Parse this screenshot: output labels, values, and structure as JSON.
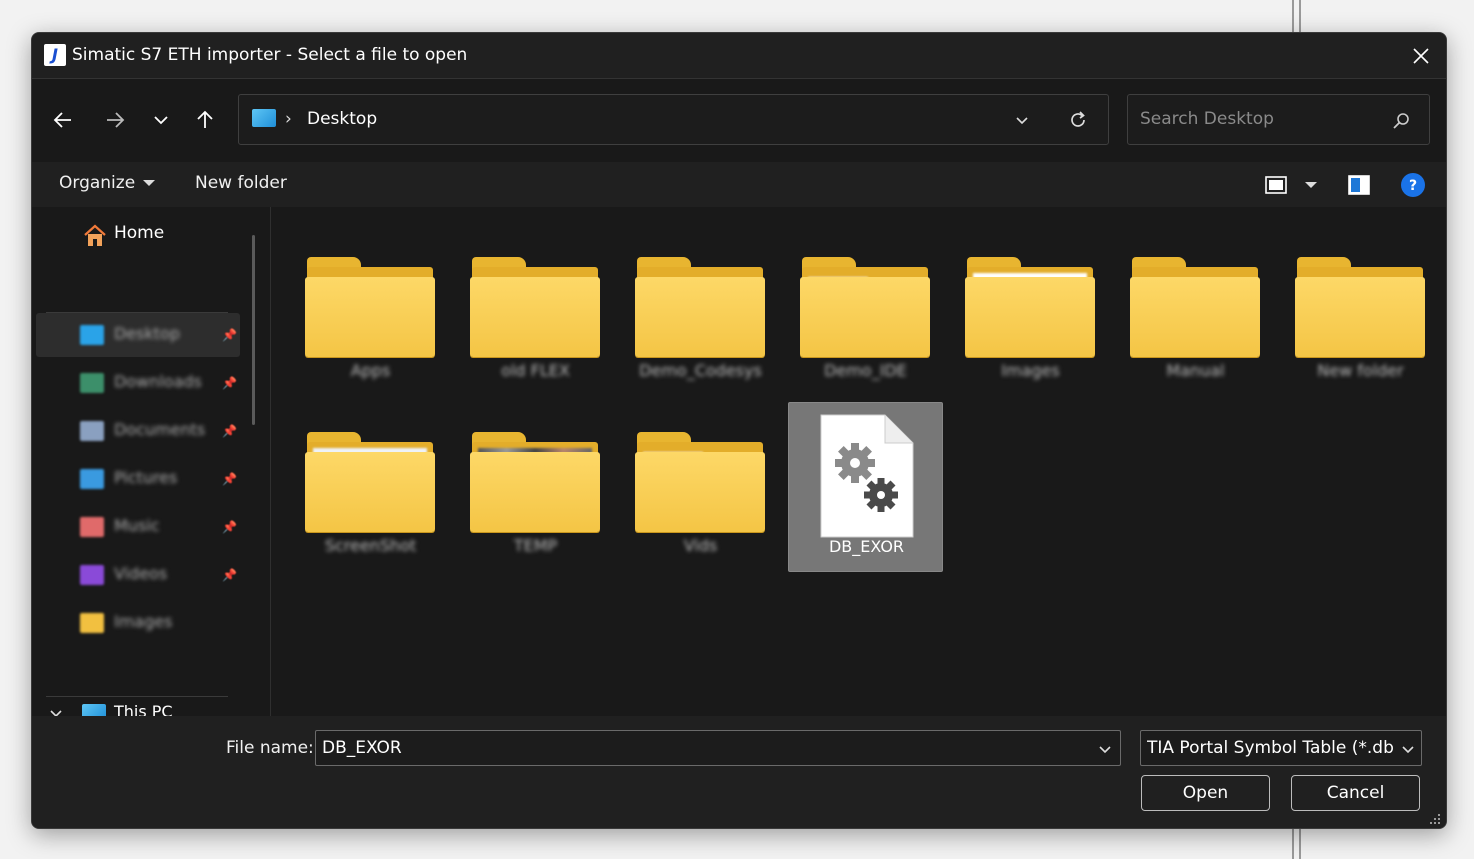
{
  "window": {
    "title": "Simatic S7 ETH importer - Select a file to open",
    "app_icon_letter": "J"
  },
  "address_bar": {
    "location": "Desktop",
    "separator": "›"
  },
  "search": {
    "placeholder": "Search Desktop"
  },
  "toolbar": {
    "organize_label": "Organize",
    "new_folder_label": "New folder"
  },
  "sidebar": {
    "home_label": "Home",
    "quick_access": [
      {
        "label": "Desktop",
        "icon": "desktop-icon",
        "color": "#2aa3e8",
        "pinned": true
      },
      {
        "label": "Downloads",
        "icon": "download-icon",
        "color": "#3c8f6a",
        "pinned": true
      },
      {
        "label": "Documents",
        "icon": "document-icon",
        "color": "#8aa0c0",
        "pinned": true
      },
      {
        "label": "Pictures",
        "icon": "picture-icon",
        "color": "#3a9ae0",
        "pinned": true
      },
      {
        "label": "Music",
        "icon": "music-icon",
        "color": "#e06a6a",
        "pinned": true
      },
      {
        "label": "Videos",
        "icon": "video-icon",
        "color": "#8a4ad8",
        "pinned": true
      },
      {
        "label": "Images",
        "icon": "folder-icon",
        "color": "#f2c040",
        "pinned": false
      }
    ],
    "this_pc_label": "This PC"
  },
  "items": [
    {
      "name": "Apps",
      "type": "folder",
      "preview": "gauge"
    },
    {
      "name": "old FLEX",
      "type": "folder",
      "preview": "doc-red"
    },
    {
      "name": "Demo_Codesys",
      "type": "folder",
      "preview": "gauge-red"
    },
    {
      "name": "Demo_IDE",
      "type": "folder",
      "preview": "line"
    },
    {
      "name": "Images",
      "type": "folder",
      "preview": "green"
    },
    {
      "name": "Manual",
      "type": "folder",
      "preview": "doc-red"
    },
    {
      "name": "New folder",
      "type": "folder",
      "preview": "none"
    },
    {
      "name": "ScreenShot",
      "type": "folder",
      "preview": "screen"
    },
    {
      "name": "TEMP",
      "type": "folder",
      "preview": "photo"
    },
    {
      "name": "Vids",
      "type": "folder",
      "preview": "line"
    },
    {
      "name": "DB_EXOR",
      "type": "file",
      "preview": "gear-file",
      "selected": true
    }
  ],
  "footer": {
    "file_name_label": "File name:",
    "file_name_value": "DB_EXOR",
    "file_type": "TIA Portal Symbol Table (*.db *.",
    "open_label": "Open",
    "cancel_label": "Cancel"
  },
  "colors": {
    "background": "#191919",
    "folder": "#f4c545",
    "accent": "#1a73e8",
    "selection": "#777777"
  }
}
